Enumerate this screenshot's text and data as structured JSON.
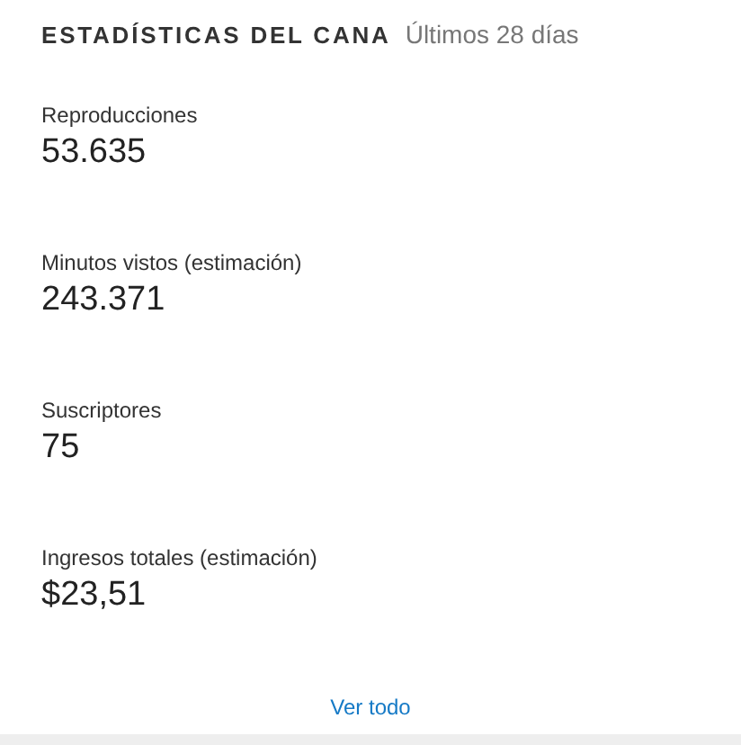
{
  "header": {
    "title": "ESTADÍSTICAS DEL CANA",
    "period": "Últimos 28 días"
  },
  "stats": [
    {
      "label": "Reproducciones",
      "value": "53.635"
    },
    {
      "label": "Minutos vistos (estimación)",
      "value": "243.371"
    },
    {
      "label": "Suscriptores",
      "value": "75"
    },
    {
      "label": "Ingresos totales (estimación)",
      "value": "$23,51"
    }
  ],
  "link": "Ver todo"
}
